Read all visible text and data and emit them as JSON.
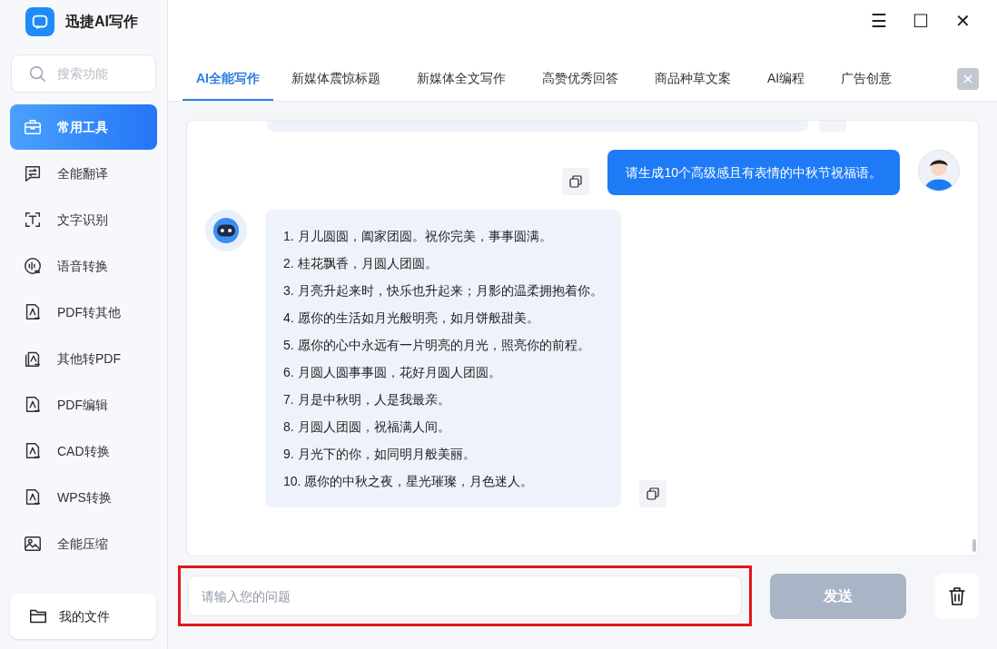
{
  "app": {
    "title": "迅捷AI写作"
  },
  "window_controls": [
    "☰",
    "☐",
    "✕"
  ],
  "sidebar": {
    "search": {
      "placeholder": "搜索功能"
    },
    "items": [
      {
        "label": "常用工具",
        "selected": true
      },
      {
        "label": "全能翻译",
        "selected": false
      },
      {
        "label": "文字识别",
        "selected": false
      },
      {
        "label": "语音转换",
        "selected": false
      },
      {
        "label": "PDF转其他",
        "selected": false
      },
      {
        "label": "其他转PDF",
        "selected": false
      },
      {
        "label": "PDF编辑",
        "selected": false
      },
      {
        "label": "CAD转换",
        "selected": false
      },
      {
        "label": "WPS转换",
        "selected": false
      },
      {
        "label": "全能压缩",
        "selected": false
      }
    ],
    "files_button": "我的文件"
  },
  "tabs": [
    {
      "label": "AI全能写作",
      "selected": true
    },
    {
      "label": "新媒体震惊标题",
      "selected": false
    },
    {
      "label": "新媒体全文写作",
      "selected": false
    },
    {
      "label": "高赞优秀回答",
      "selected": false
    },
    {
      "label": "商品种草文案",
      "selected": false
    },
    {
      "label": "AI编程",
      "selected": false
    },
    {
      "label": "广告创意",
      "selected": false
    }
  ],
  "chat": [
    {
      "kind": "user",
      "text": "请生成10个高级感且有表情的中秋节祝福语。"
    },
    {
      "kind": "bot",
      "lines": [
        "1. 月儿圆圆，阖家团圆。祝你完美，事事圆满。",
        "2. 桂花飘香，月圆人团圆。",
        "3. 月亮升起来时，快乐也升起来；月影的温柔拥抱着你。",
        "4. 愿你的生活如月光般明亮，如月饼般甜美。",
        "5. 愿你的心中永远有一片明亮的月光，照亮你的前程。",
        "6. 月圆人圆事事圆，花好月圆人团圆。",
        "7. 月是中秋明，人是我最亲。",
        "8. 月圆人团圆，祝福满人间。",
        "9. 月光下的你，如同明月般美丽。",
        "10. 愿你的中秋之夜，星光璀璨，月色迷人。"
      ]
    }
  ],
  "input": {
    "placeholder": "请输入您的问题",
    "highlighted": true
  },
  "send_button": {
    "label": "发送",
    "disabled": true
  }
}
